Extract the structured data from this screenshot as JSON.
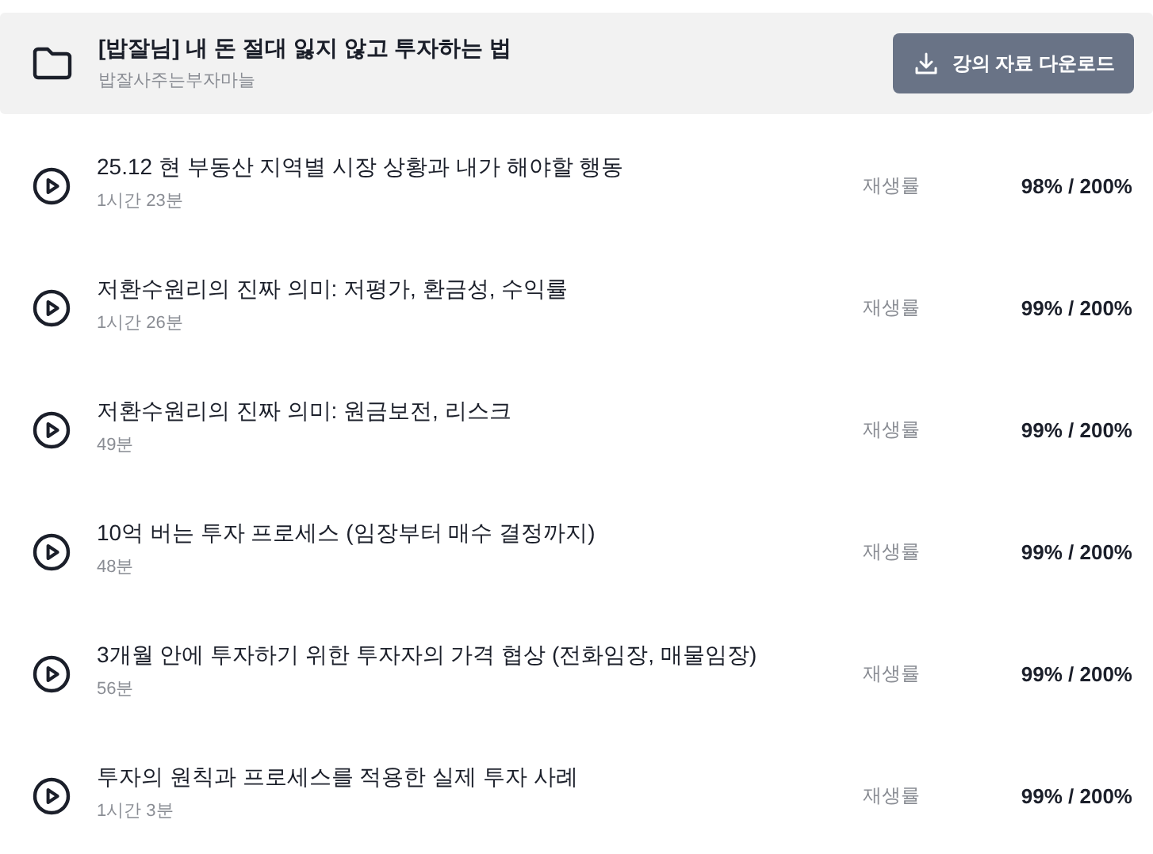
{
  "course": {
    "title": "[밥잘님] 내 돈 절대 잃지 않고 투자하는 법",
    "author": "밥잘사주는부자마늘",
    "download_button": "강의 자료 다운로드"
  },
  "lectures": [
    {
      "title": "25.12 현 부동산 지역별 시장 상황과 내가 해야할 행동",
      "duration": "1시간 23분",
      "rate_label": "재생률",
      "rate": "98% / 200%"
    },
    {
      "title": "저환수원리의 진짜 의미: 저평가, 환금성, 수익률",
      "duration": "1시간 26분",
      "rate_label": "재생률",
      "rate": "99% / 200%"
    },
    {
      "title": "저환수원리의 진짜 의미: 원금보전, 리스크",
      "duration": "49분",
      "rate_label": "재생률",
      "rate": "99% / 200%"
    },
    {
      "title": "10억 버는 투자 프로세스 (임장부터 매수 결정까지)",
      "duration": "48분",
      "rate_label": "재생률",
      "rate": "99% / 200%"
    },
    {
      "title": "3개월 안에 투자하기 위한 투자자의 가격 협상 (전화임장, 매물임장)",
      "duration": "56분",
      "rate_label": "재생률",
      "rate": "99% / 200%"
    },
    {
      "title": "투자의 원칙과 프로세스를 적용한 실제 투자 사례",
      "duration": "1시간 3분",
      "rate_label": "재생률",
      "rate": "99% / 200%"
    }
  ]
}
